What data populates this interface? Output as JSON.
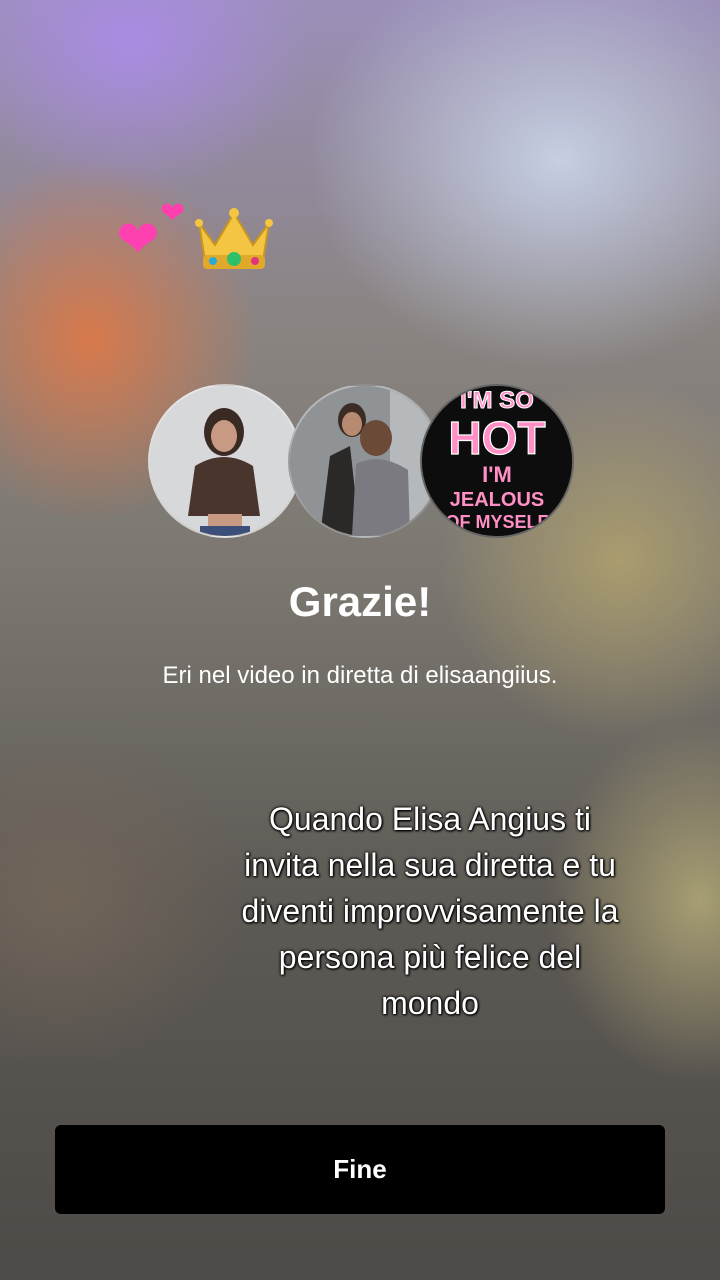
{
  "sticker": {
    "icons": [
      "two-hearts-icon",
      "crown-icon"
    ]
  },
  "avatars": [
    {
      "name": "avatar-1",
      "icon": "woman-photo"
    },
    {
      "name": "avatar-2",
      "icon": "couple-photo"
    },
    {
      "name": "avatar-3",
      "text_lines": [
        "I'M SO",
        "HOT",
        "I'M",
        "JEALOUS",
        "OF MYSELF"
      ]
    }
  ],
  "thanks": {
    "title": "Grazie!",
    "subtitle": "Eri nel video in diretta di elisaangiius."
  },
  "caption": {
    "text": "Quando Elisa Angius ti invita nella sua diretta e tu diventi improvvisamente la persona più felice del mondo"
  },
  "actions": {
    "done_label": "Fine"
  },
  "colors": {
    "button_bg": "#000000",
    "heart": "#ff40b0",
    "poster_text": "#ff8fc4"
  }
}
